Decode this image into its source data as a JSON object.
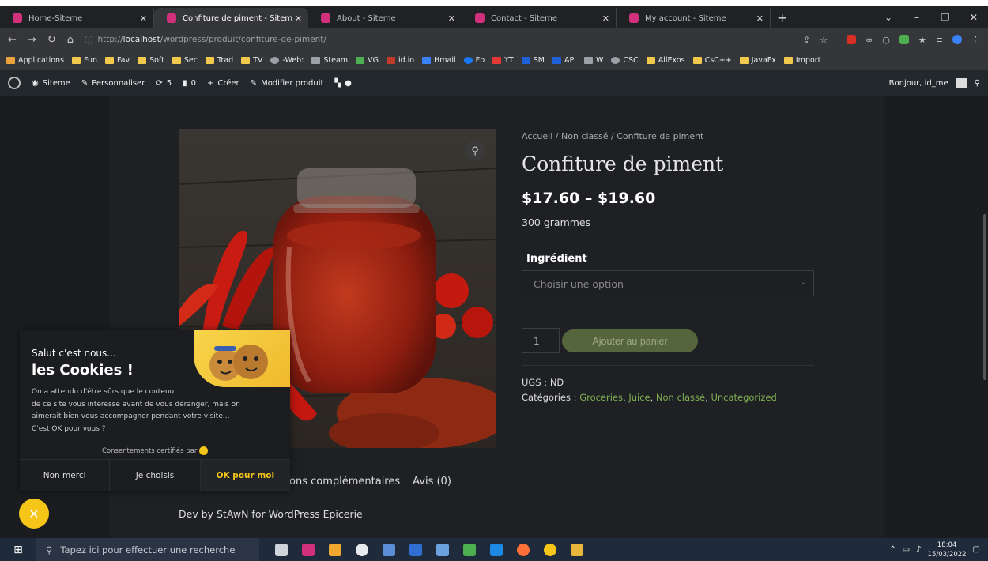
{
  "browser": {
    "tabs": [
      {
        "title": "Home-Siteme",
        "active": false
      },
      {
        "title": "Confiture de piment - Siteme",
        "active": true
      },
      {
        "title": "About - Siteme",
        "active": false
      },
      {
        "title": "Contact - Siteme",
        "active": false
      },
      {
        "title": "My account - Siteme",
        "active": false
      }
    ],
    "url_prefix": "http://",
    "url_host": "localhost",
    "url_path": "/wordpress/produit/confiture-de-piment/",
    "bookmarks": [
      {
        "label": "Applications",
        "color": "#e8a33d"
      },
      {
        "label": "Fun",
        "color": "#f2c94c"
      },
      {
        "label": "Fav",
        "color": "#f2c94c"
      },
      {
        "label": "Soft",
        "color": "#f2c94c"
      },
      {
        "label": "Sec",
        "color": "#f2c94c"
      },
      {
        "label": "Trad",
        "color": "#f2c94c"
      },
      {
        "label": "TV",
        "color": "#f2c94c"
      },
      {
        "label": "-Web:",
        "color": "#9aa0a6"
      },
      {
        "label": "Steam",
        "color": "#9aa0a6"
      },
      {
        "label": "VG",
        "color": "#4caf50"
      },
      {
        "label": "id.io",
        "color": "#c0392b"
      },
      {
        "label": "Hmail",
        "color": "#3b82f6"
      },
      {
        "label": "Fb",
        "color": "#1877f2"
      },
      {
        "label": "YT",
        "color": "#e53935"
      },
      {
        "label": "SM",
        "color": "#1e60d8"
      },
      {
        "label": "API",
        "color": "#1e60d8"
      },
      {
        "label": "W",
        "color": "#9aa0a6"
      },
      {
        "label": "CSC",
        "color": "#9aa0a6"
      },
      {
        "label": "AllExos",
        "color": "#f2c94c"
      },
      {
        "label": "CsC++",
        "color": "#f2c94c"
      },
      {
        "label": "JavaFx",
        "color": "#f2c94c"
      },
      {
        "label": "Import",
        "color": "#f2c94c"
      }
    ]
  },
  "adminbar": {
    "site": "Siteme",
    "customize": "Personnaliser",
    "updates": "5",
    "comments": "0",
    "new": "Créer",
    "edit": "Modifier produit",
    "greeting": "Bonjour, id_me"
  },
  "product": {
    "breadcrumb": "Accueil / Non classé / Confiture de piment",
    "title": "Confiture de piment",
    "price": "$17.60 – $19.60",
    "weight": "300 grammes",
    "ingredient_label": "Ingrédient",
    "select_placeholder": "Choisir une option",
    "quantity": "1",
    "add_to_cart": "Ajouter au panier",
    "sku": "UGS : ND",
    "categories_label": "Catégories :",
    "categories": [
      "Groceries",
      "Juice",
      "Non classé",
      "Uncategorized"
    ],
    "tab_info": "ons complémentaires",
    "tab_reviews": "Avis (0)",
    "footer": "Dev by StAwN for WordPress Epicerie"
  },
  "cookie": {
    "greeting": "Salut c'est nous...",
    "title": "les Cookies !",
    "lines": [
      "On a attendu d'être sûrs que le contenu",
      "de ce site vous intéresse avant de vous déranger, mais on",
      "aimerait bien vous accompagner pendant votre visite...",
      "C'est OK pour vous ?"
    ],
    "certified": "Consentements certifiés par",
    "btn_no": "Non merci",
    "btn_choose": "Je choisis",
    "btn_ok": "OK pour moi"
  },
  "taskbar": {
    "search_placeholder": "Tapez ici pour effectuer une recherche",
    "time": "18:04",
    "date": "15/03/2022"
  }
}
